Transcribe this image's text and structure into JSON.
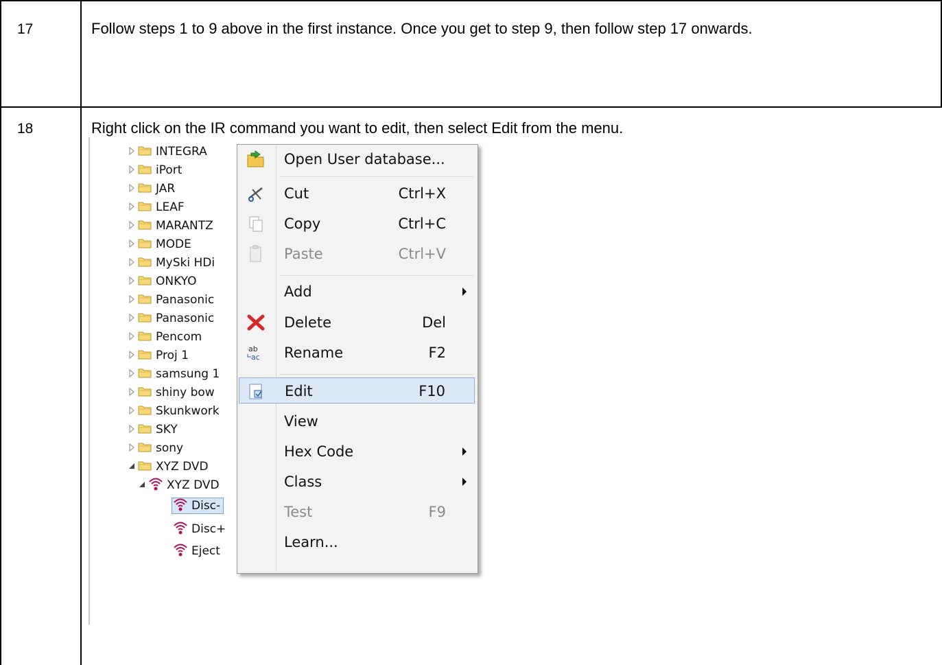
{
  "rows": [
    {
      "number": "17",
      "text": "Follow steps 1 to 9 above in the first instance. Once you get to step 9, then follow step 17 onwards."
    },
    {
      "number": "18",
      "text": "Right click on the IR command you want to edit, then select Edit from the menu."
    }
  ],
  "tree": {
    "folders": [
      "INTEGRA",
      "iPort",
      "JAR",
      "LEAF",
      "MARANTZ",
      "MODE",
      "MySki HDi",
      "ONKYO",
      "Panasonic",
      "Panasonic",
      "Pencom",
      "Proj 1",
      "samsung 1",
      "shiny bow",
      "Skunkwork",
      "SKY",
      "sony",
      "XYZ DVD"
    ],
    "device": "XYZ DVD",
    "commands": [
      {
        "name": "Disc-",
        "status": "Undefined",
        "selected": true
      },
      {
        "name": "Disc+",
        "status": "Undefined"
      },
      {
        "name": "Eject",
        "status": "Undefined"
      }
    ]
  },
  "context_menu": {
    "items": [
      {
        "label": "Open User database...",
        "shortcut": "",
        "icon": "open-database-icon"
      },
      {
        "label": "Cut",
        "shortcut": "Ctrl+X",
        "icon": "cut-icon"
      },
      {
        "label": "Copy",
        "shortcut": "Ctrl+C",
        "icon": "copy-icon"
      },
      {
        "label": "Paste",
        "shortcut": "Ctrl+V",
        "icon": "paste-icon",
        "disabled": true
      },
      {
        "label": "Add",
        "shortcut": "",
        "submenu": true
      },
      {
        "label": "Delete",
        "shortcut": "Del",
        "icon": "delete-icon"
      },
      {
        "label": "Rename",
        "shortcut": "F2",
        "icon": "rename-icon"
      },
      {
        "label": "Edit",
        "shortcut": "F10",
        "icon": "edit-icon",
        "highlighted": true
      },
      {
        "label": "View",
        "shortcut": ""
      },
      {
        "label": "Hex Code",
        "shortcut": "",
        "submenu": true
      },
      {
        "label": "Class",
        "shortcut": "",
        "submenu": true
      },
      {
        "label": "Test",
        "shortcut": "F9",
        "disabled": true
      },
      {
        "label": "Learn...",
        "shortcut": ""
      }
    ]
  },
  "colors": {
    "folder": "#f6d77a",
    "menu_highlight": "#dce8f5",
    "ir_icon": "#b0105a",
    "disabled_text": "#8a8a8a"
  }
}
